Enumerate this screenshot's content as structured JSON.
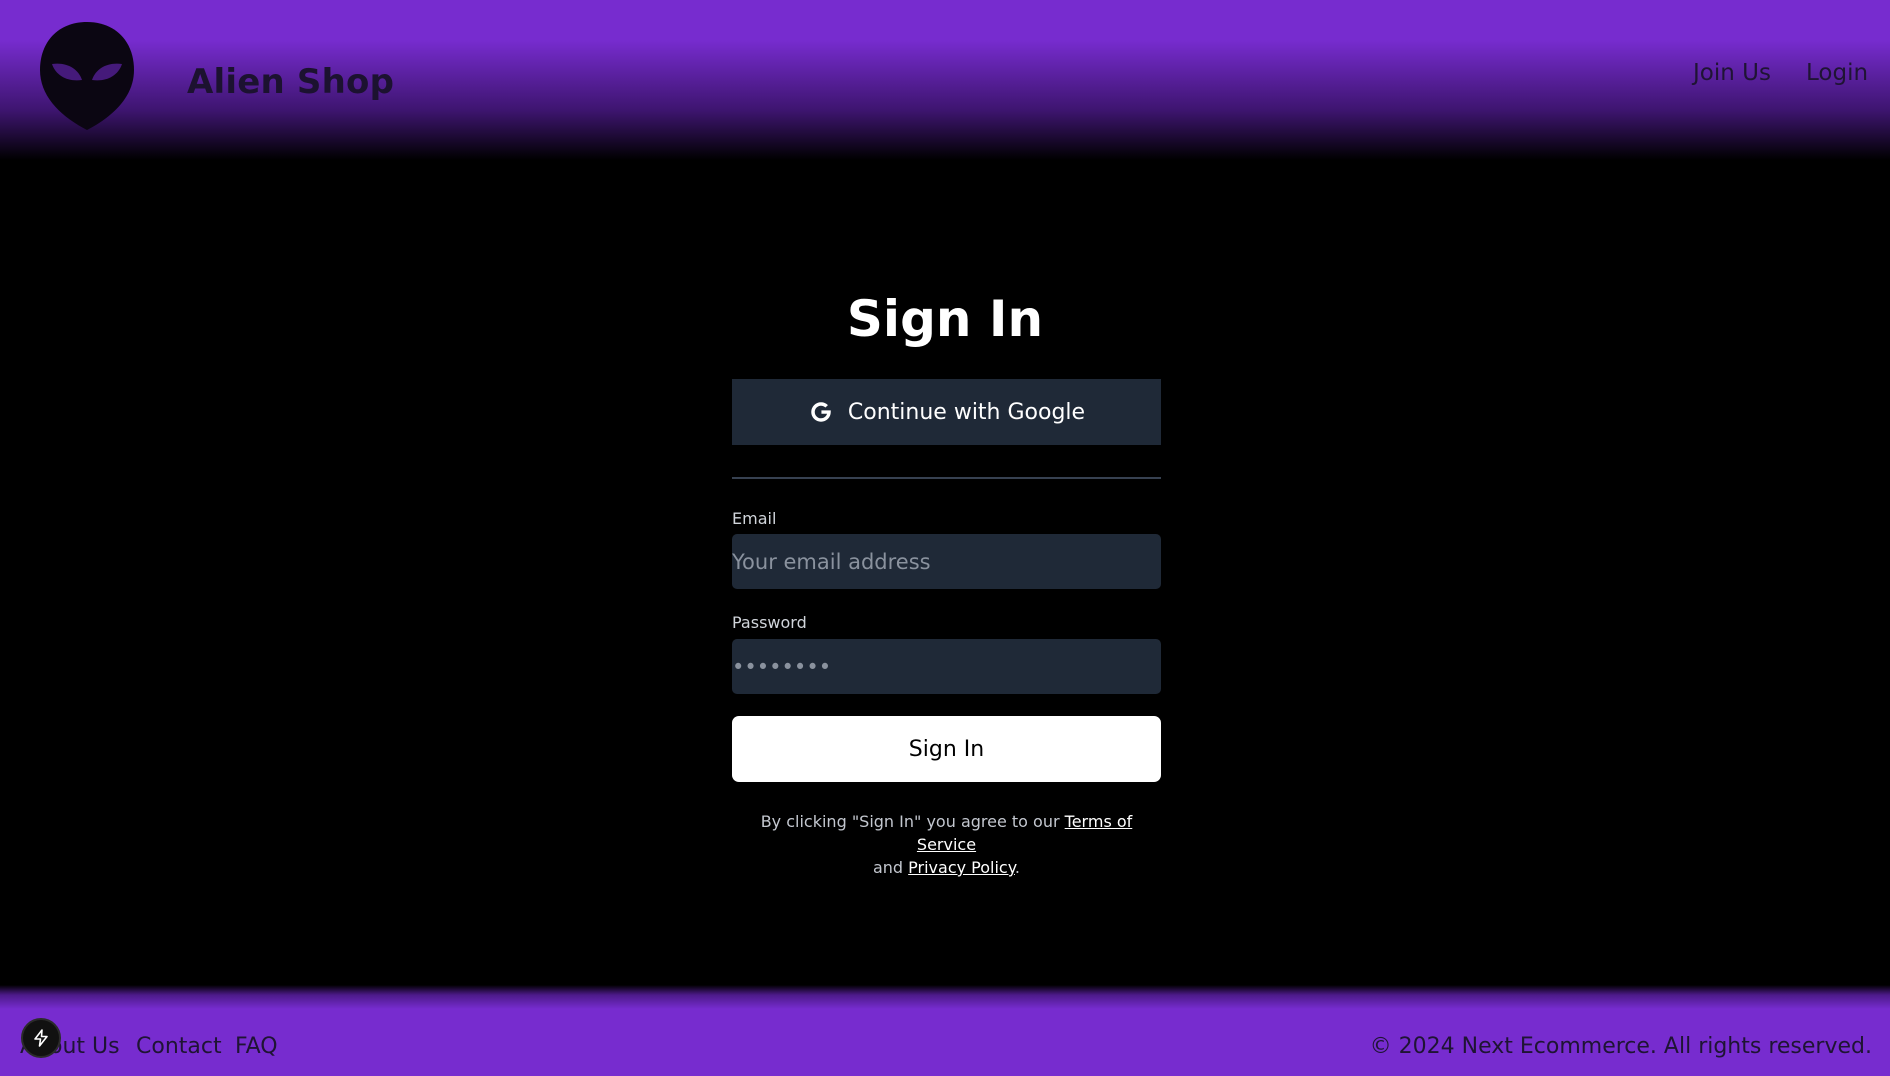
{
  "header": {
    "brand": "Alien Shop",
    "nav": {
      "join_label": "Join Us",
      "login_label": "Login"
    }
  },
  "signin": {
    "title": "Sign In",
    "google_label": "Continue with Google",
    "email_label": "Email",
    "email_placeholder": "Your email address",
    "password_label": "Password",
    "password_placeholder": "••••••••",
    "submit_label": "Sign In",
    "terms_prefix": "By clicking \"Sign In\" you agree to our ",
    "terms_link": "Terms of Service",
    "terms_and": "and ",
    "privacy_link": "Privacy Policy",
    "terms_suffix": "."
  },
  "footer": {
    "about_label": "About Us",
    "contact_label": "Contact",
    "faq_label": "FAQ",
    "copyright": "© 2024 Next Ecommerce. All rights reserved."
  },
  "colors": {
    "brand_purple": "#772ccf",
    "input_bg": "#1f2937",
    "background": "#000000"
  }
}
